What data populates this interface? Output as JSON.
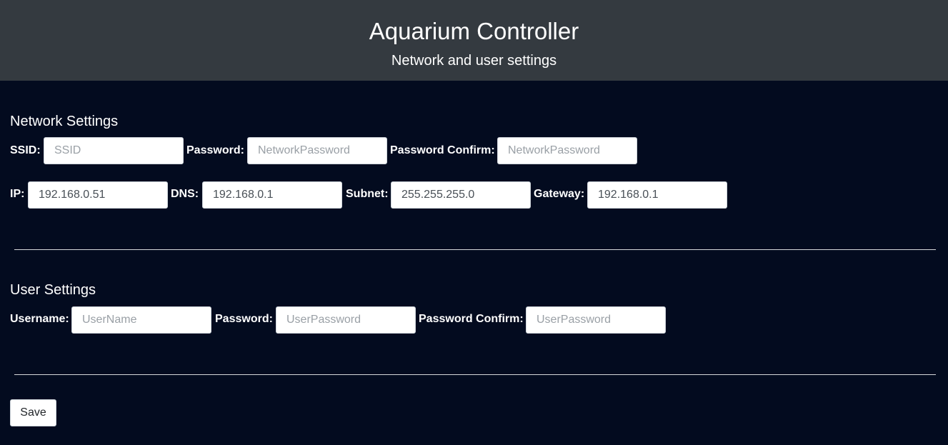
{
  "header": {
    "title": "Aquarium Controller",
    "subtitle": "Network and user settings"
  },
  "network": {
    "section_title": "Network Settings",
    "ssid": {
      "label": "SSID:",
      "value": "",
      "placeholder": "SSID"
    },
    "password": {
      "label": "Password:",
      "value": "",
      "placeholder": "NetworkPassword"
    },
    "password_confirm": {
      "label": "Password Confirm:",
      "value": "",
      "placeholder": "NetworkPassword"
    },
    "ip": {
      "label": "IP:",
      "value": "192.168.0.51"
    },
    "dns": {
      "label": "DNS:",
      "value": "192.168.0.1"
    },
    "subnet": {
      "label": "Subnet:",
      "value": "255.255.255.0"
    },
    "gateway": {
      "label": "Gateway:",
      "value": "192.168.0.1"
    }
  },
  "user": {
    "section_title": "User Settings",
    "username": {
      "label": "Username:",
      "value": "",
      "placeholder": "UserName"
    },
    "password": {
      "label": "Password:",
      "value": "",
      "placeholder": "UserPassword"
    },
    "password_confirm": {
      "label": "Password Confirm:",
      "value": "",
      "placeholder": "UserPassword"
    }
  },
  "actions": {
    "save_label": "Save"
  },
  "colors": {
    "header_bg": "#343a40",
    "page_bg": "#030b1f",
    "text": "#ffffff"
  }
}
